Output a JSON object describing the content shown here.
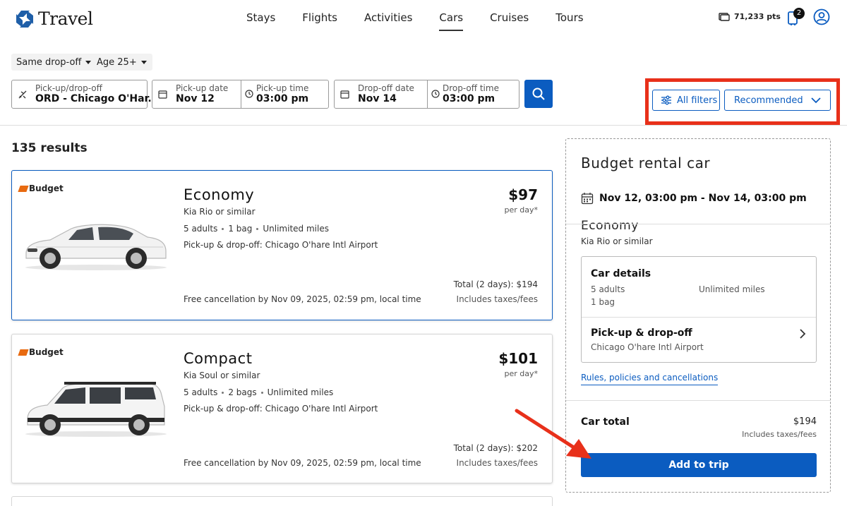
{
  "header": {
    "logo_text": "Travel",
    "nav": [
      "Stays",
      "Flights",
      "Activities",
      "Cars",
      "Cruises",
      "Tours"
    ],
    "active_nav": "Cars",
    "points": "71,233 pts",
    "trips_badge": "2"
  },
  "filters": {
    "dropoff": "Same drop-off",
    "age": "Age 25+"
  },
  "search": {
    "location_label": "Pick-up/drop-off",
    "location_value": "ORD - Chicago O'Har...",
    "pickup_date_label": "Pick-up date",
    "pickup_date_value": "Nov 12",
    "pickup_time_label": "Pick-up time",
    "pickup_time_value": "03:00 pm",
    "dropoff_date_label": "Drop-off date",
    "dropoff_date_value": "Nov 14",
    "dropoff_time_label": "Drop-off time",
    "dropoff_time_value": "03:00 pm"
  },
  "toolbar": {
    "all_filters": "All filters",
    "sort": "Recommended"
  },
  "results_count": "135 results",
  "cars": [
    {
      "brand": "Budget",
      "title": "Economy",
      "model": "Kia Rio or similar",
      "adults": "5 adults",
      "bags": "1 bag",
      "miles": "Unlimited miles",
      "pickup": "Pick-up & drop-off: Chicago O'hare Intl Airport",
      "price": "$97",
      "per_day": "per day*",
      "total": "Total (2 days): $194",
      "taxes": "Includes taxes/fees",
      "cancellation": "Free cancellation by Nov 09, 2025, 02:59 pm, local time"
    },
    {
      "brand": "Budget",
      "title": "Compact",
      "model": "Kia Soul or similar",
      "adults": "5 adults",
      "bags": "2 bags",
      "miles": "Unlimited miles",
      "pickup": "Pick-up & drop-off: Chicago O'hare Intl Airport",
      "price": "$101",
      "per_day": "per day*",
      "total": "Total (2 days): $202",
      "taxes": "Includes taxes/fees",
      "cancellation": "Free cancellation by Nov 09, 2025, 02:59 pm, local time"
    }
  ],
  "panel": {
    "title": "Budget rental car",
    "dates": "Nov 12, 03:00 pm - Nov 14, 03:00 pm",
    "car_class": "Economy",
    "car_model": "Kia Rio or similar",
    "details_title": "Car details",
    "adults": "5 adults",
    "bag": "1 bag",
    "miles": "Unlimited miles",
    "pickup_title": "Pick-up & drop-off",
    "pickup_value": "Chicago O'hare Intl Airport",
    "rules_link": "Rules, policies and cancellations",
    "total_label": "Car total",
    "total_value": "$194",
    "taxes": "Includes taxes/fees",
    "add_button": "Add to trip"
  },
  "colors": {
    "primary": "#0b5cc0",
    "annotation": "#e8301a",
    "budget_orange": "#e86a10"
  }
}
